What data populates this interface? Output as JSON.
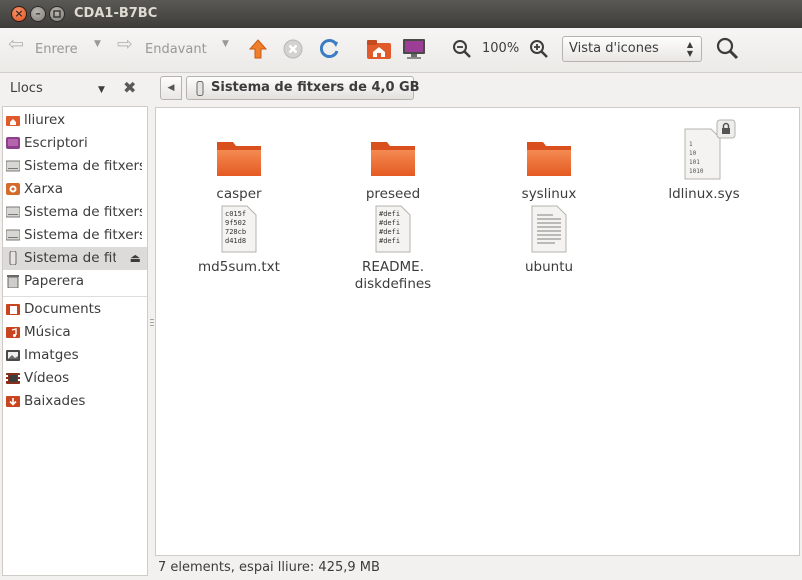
{
  "window": {
    "title": "CDA1-B7BC"
  },
  "toolbar": {
    "back_label": "Enrere",
    "forward_label": "Endavant",
    "zoom_level": "100%",
    "view_mode": "Vista d'icones"
  },
  "sidebar": {
    "header": "Llocs",
    "items": [
      {
        "label": "lliurex",
        "icon": "home-folder-icon"
      },
      {
        "label": "Escriptori",
        "icon": "desktop-icon"
      },
      {
        "label": "Sistema de fitxers",
        "icon": "drive-icon"
      },
      {
        "label": "Xarxa",
        "icon": "network-icon"
      },
      {
        "label": "Sistema de fitxers",
        "icon": "drive-icon"
      },
      {
        "label": "Sistema de fitxers",
        "icon": "drive-icon"
      },
      {
        "label": "Sistema de fitxers",
        "icon": "usb-drive-icon"
      },
      {
        "label": "Paperera",
        "icon": "trash-icon"
      },
      {
        "label": "Documents",
        "icon": "documents-folder-icon"
      },
      {
        "label": "Música",
        "icon": "music-folder-icon"
      },
      {
        "label": "Imatges",
        "icon": "pictures-folder-icon"
      },
      {
        "label": "Vídeos",
        "icon": "videos-folder-icon"
      },
      {
        "label": "Baixades",
        "icon": "downloads-folder-icon"
      }
    ]
  },
  "pathbar": {
    "location": "Sistema de fitxers de 4,0 GB"
  },
  "files": [
    {
      "name": "casper",
      "type": "folder"
    },
    {
      "name": "preseed",
      "type": "folder"
    },
    {
      "name": "syslinux",
      "type": "folder"
    },
    {
      "name": "ldlinux.sys",
      "type": "binary-locked"
    },
    {
      "name": "md5sum.txt",
      "type": "text",
      "preview": [
        "c015f",
        "9f502",
        "728cb",
        "d41d8"
      ]
    },
    {
      "name": "README.\ndiskdefines",
      "type": "text",
      "preview": [
        "#defi",
        "#defi",
        "#defi",
        "#defi"
      ]
    },
    {
      "name": "ubuntu",
      "type": "document"
    }
  ],
  "binary_preview": [
    "1",
    "10",
    "101",
    "1010"
  ],
  "status": {
    "text": "7 elements, espai lliure: 425,9 MB"
  }
}
